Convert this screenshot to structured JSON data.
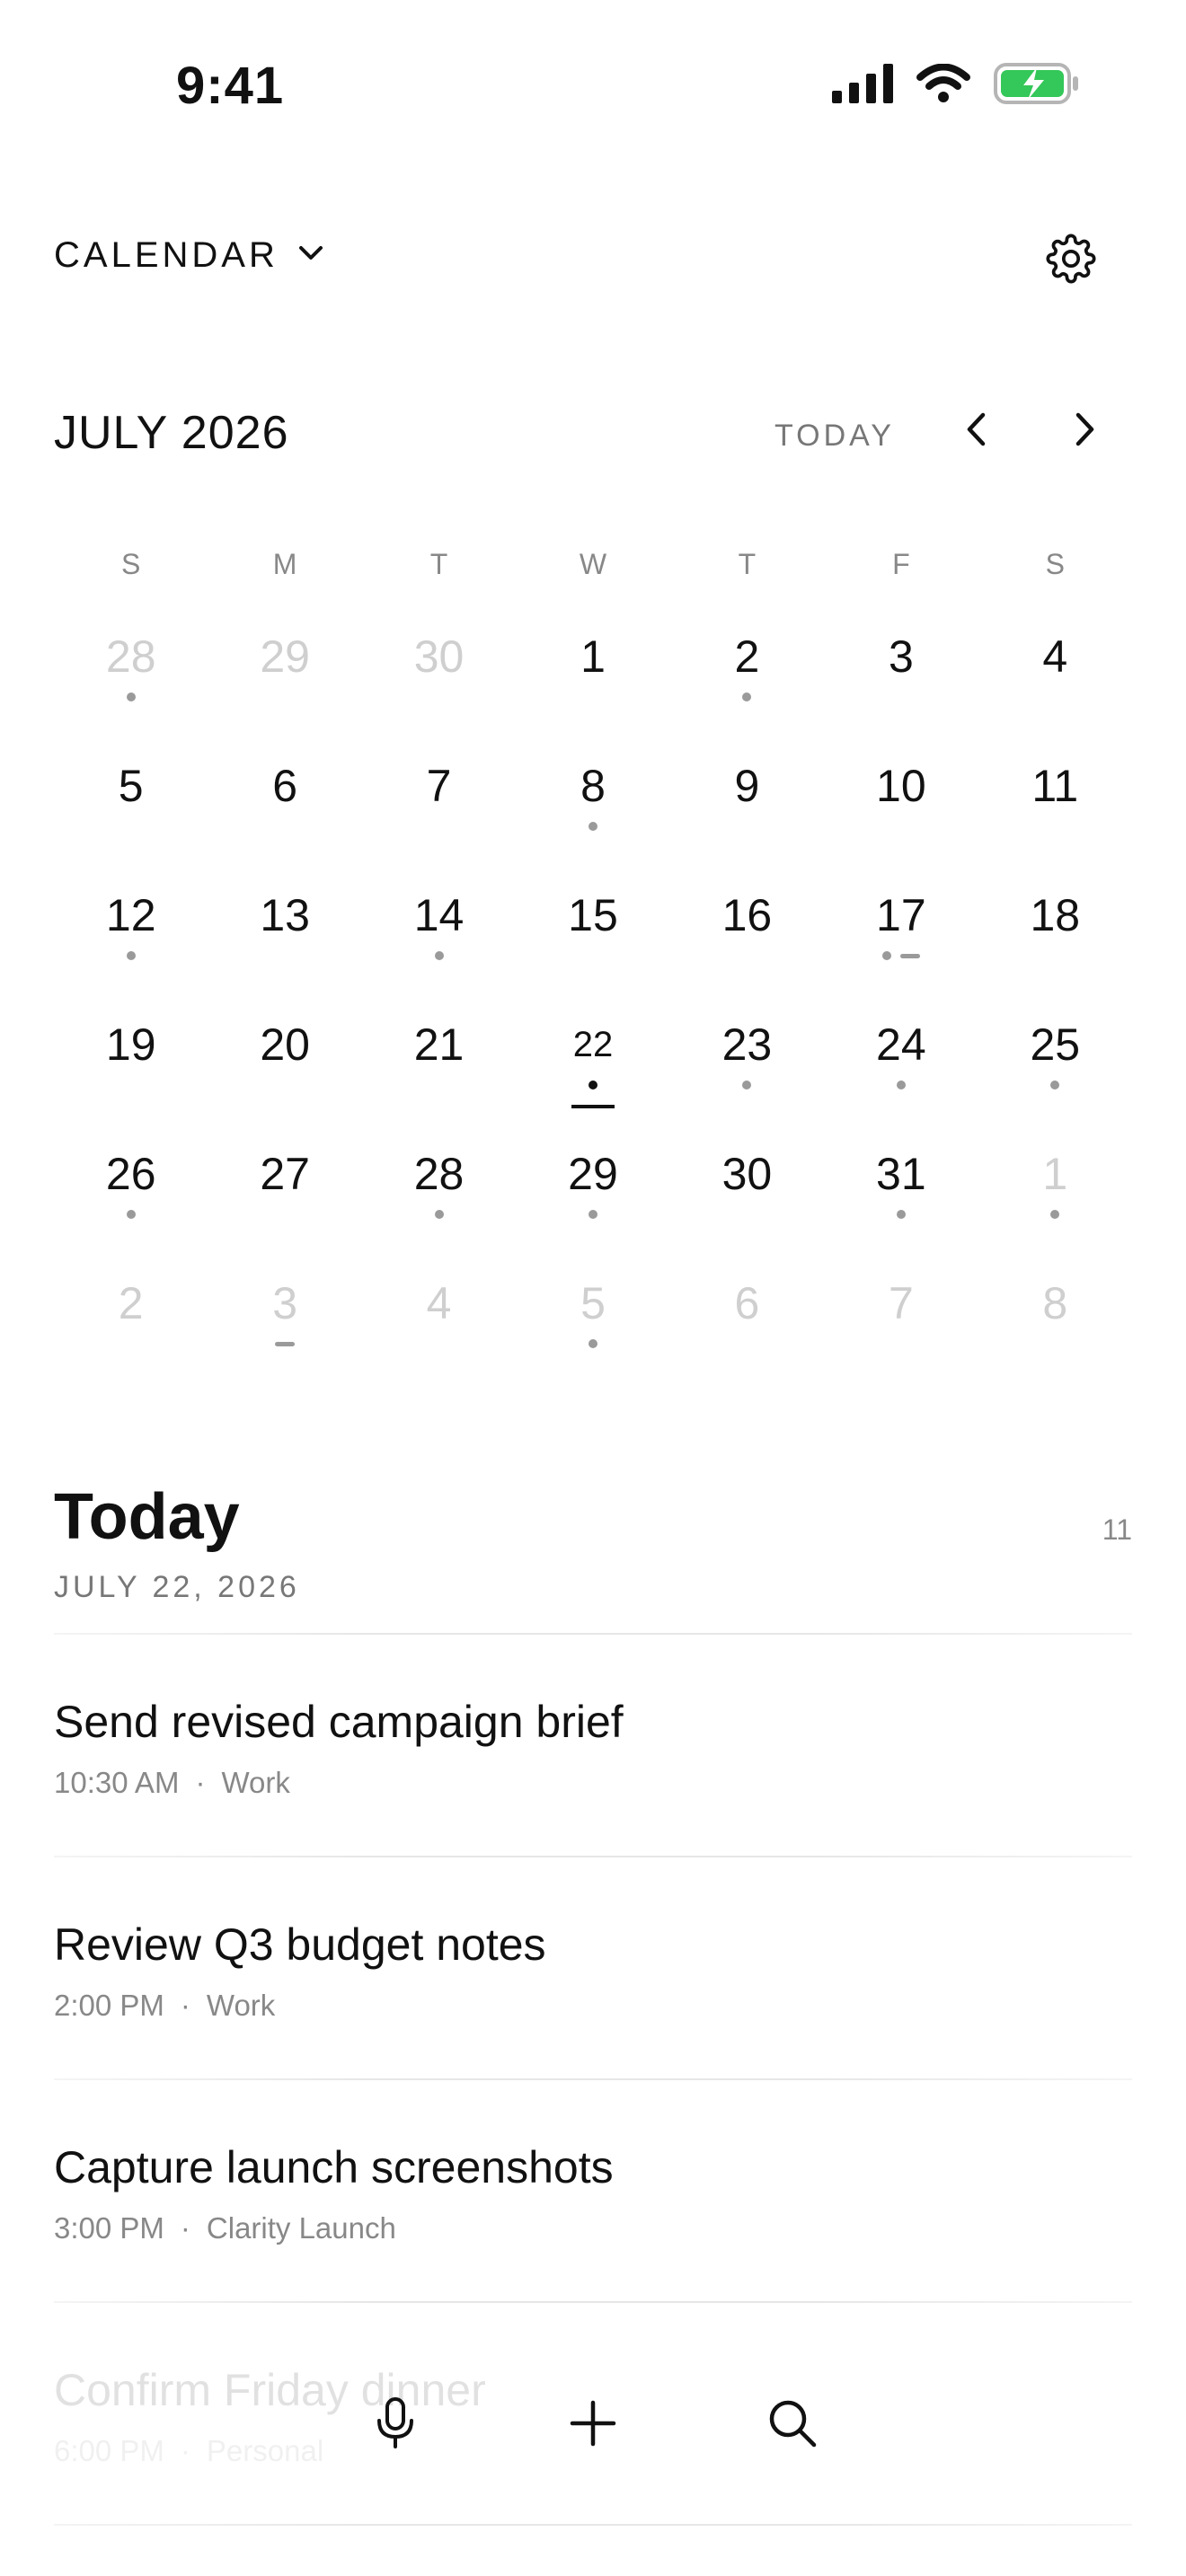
{
  "status_bar": {
    "time": "9:41"
  },
  "header": {
    "calendar_label": "CALENDAR"
  },
  "month": {
    "title": "JULY 2026",
    "today_label": "TODAY"
  },
  "weekdays": [
    "S",
    "M",
    "T",
    "W",
    "T",
    "F",
    "S"
  ],
  "days": [
    {
      "n": "28",
      "muted": true,
      "marks": [
        "dot"
      ]
    },
    {
      "n": "29",
      "muted": true,
      "marks": []
    },
    {
      "n": "30",
      "muted": true,
      "marks": []
    },
    {
      "n": "1",
      "muted": false,
      "marks": []
    },
    {
      "n": "2",
      "muted": false,
      "marks": [
        "dot"
      ]
    },
    {
      "n": "3",
      "muted": false,
      "marks": []
    },
    {
      "n": "4",
      "muted": false,
      "marks": []
    },
    {
      "n": "5",
      "muted": false,
      "marks": []
    },
    {
      "n": "6",
      "muted": false,
      "marks": []
    },
    {
      "n": "7",
      "muted": false,
      "marks": []
    },
    {
      "n": "8",
      "muted": false,
      "marks": [
        "dot"
      ]
    },
    {
      "n": "9",
      "muted": false,
      "marks": []
    },
    {
      "n": "10",
      "muted": false,
      "marks": []
    },
    {
      "n": "11",
      "muted": false,
      "marks": []
    },
    {
      "n": "12",
      "muted": false,
      "marks": [
        "dot"
      ]
    },
    {
      "n": "13",
      "muted": false,
      "marks": []
    },
    {
      "n": "14",
      "muted": false,
      "marks": [
        "dot"
      ]
    },
    {
      "n": "15",
      "muted": false,
      "marks": []
    },
    {
      "n": "16",
      "muted": false,
      "marks": []
    },
    {
      "n": "17",
      "muted": false,
      "marks": [
        "dot",
        "dash"
      ]
    },
    {
      "n": "18",
      "muted": false,
      "marks": []
    },
    {
      "n": "19",
      "muted": false,
      "marks": []
    },
    {
      "n": "20",
      "muted": false,
      "marks": []
    },
    {
      "n": "21",
      "muted": false,
      "marks": []
    },
    {
      "n": "22",
      "muted": false,
      "selected": true,
      "marks": [
        "dot"
      ]
    },
    {
      "n": "23",
      "muted": false,
      "marks": [
        "dot"
      ]
    },
    {
      "n": "24",
      "muted": false,
      "marks": [
        "dot"
      ]
    },
    {
      "n": "25",
      "muted": false,
      "marks": [
        "dot"
      ]
    },
    {
      "n": "26",
      "muted": false,
      "marks": [
        "dot"
      ]
    },
    {
      "n": "27",
      "muted": false,
      "marks": []
    },
    {
      "n": "28",
      "muted": false,
      "marks": [
        "dot"
      ]
    },
    {
      "n": "29",
      "muted": false,
      "marks": [
        "dot"
      ]
    },
    {
      "n": "30",
      "muted": false,
      "marks": []
    },
    {
      "n": "31",
      "muted": false,
      "marks": [
        "dot"
      ]
    },
    {
      "n": "1",
      "muted": true,
      "marks": [
        "dot"
      ]
    },
    {
      "n": "2",
      "muted": true,
      "marks": []
    },
    {
      "n": "3",
      "muted": true,
      "marks": [
        "dash"
      ]
    },
    {
      "n": "4",
      "muted": true,
      "marks": []
    },
    {
      "n": "5",
      "muted": true,
      "marks": [
        "dot"
      ]
    },
    {
      "n": "6",
      "muted": true,
      "marks": []
    },
    {
      "n": "7",
      "muted": true,
      "marks": []
    },
    {
      "n": "8",
      "muted": true,
      "marks": []
    }
  ],
  "today": {
    "title": "Today",
    "date": "JULY 22, 2026",
    "count": "11",
    "separator": "·",
    "tasks": [
      {
        "title": "Send revised campaign brief",
        "time": "10:30 AM",
        "list": "Work"
      },
      {
        "title": "Review Q3 budget notes",
        "time": "2:00 PM",
        "list": "Work"
      },
      {
        "title": "Capture launch screenshots",
        "time": "3:00 PM",
        "list": "Clarity Launch"
      },
      {
        "title": "Confirm Friday dinner",
        "time": "6:00 PM",
        "list": "Personal"
      }
    ]
  },
  "colors": {
    "battery_green": "#34c759",
    "text": "#111111",
    "muted_text": "#888888",
    "mark_grey": "#9a9a9a"
  },
  "icons": [
    "signal-icon",
    "wifi-icon",
    "battery-icon",
    "chevron-down-icon",
    "gear-icon",
    "chevron-left-icon",
    "chevron-right-icon",
    "microphone-icon",
    "plus-icon",
    "search-icon"
  ]
}
